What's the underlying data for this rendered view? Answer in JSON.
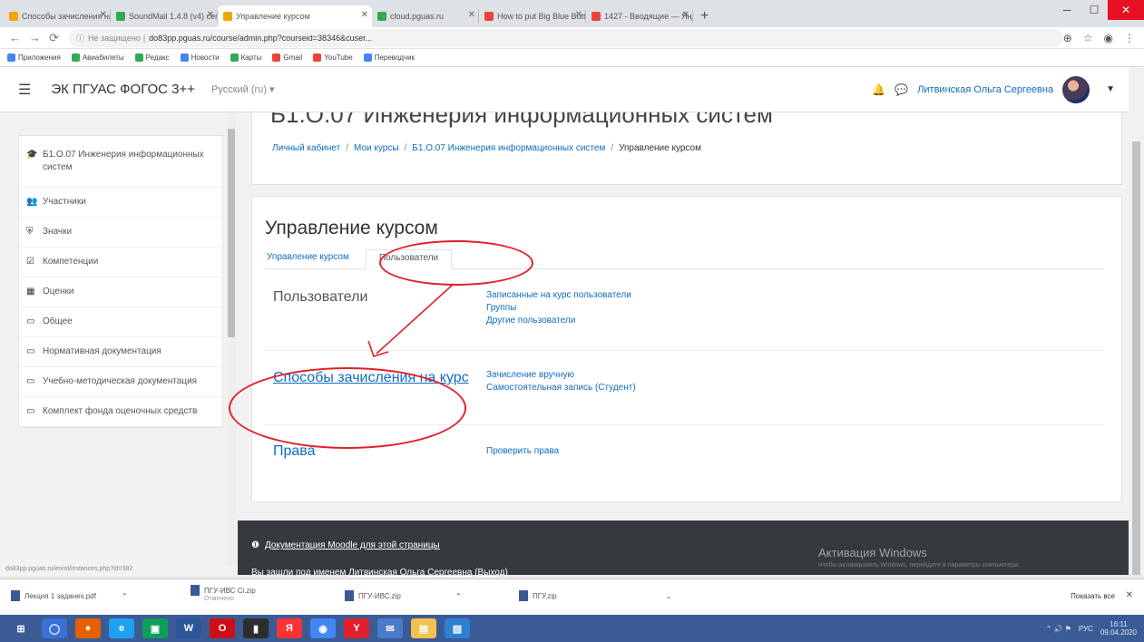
{
  "browser": {
    "tabs": [
      {
        "label": "Способы зачисления на курс",
        "color": "#f4a400"
      },
      {
        "label": "SoundMail 1.4.8 (v4) cemr...",
        "color": "#34a853"
      },
      {
        "label": "Управление курсом",
        "color": "#f4a400",
        "active": true
      },
      {
        "label": "cloud.pguas.ru",
        "color": "#34a853"
      },
      {
        "label": "How to put Big Blue Button i...",
        "color": "#ea4335"
      },
      {
        "label": "1427 - Вводящие — Яндекс...",
        "color": "#ea4335"
      }
    ],
    "url_prefix": "Не защищено",
    "url": "do83pp.pguas.ru/course/admin.php?courseid=38346&cuser...",
    "bookmarks": [
      {
        "label": "Приложения",
        "color": "#4285f4"
      },
      {
        "label": "Авиабилеты",
        "color": "#34a853"
      },
      {
        "label": "Редакс",
        "color": "#34a853"
      },
      {
        "label": "Новости",
        "color": "#4285f4"
      },
      {
        "label": "Карты",
        "color": "#34a853"
      },
      {
        "label": "Gmail",
        "color": "#ea4335"
      },
      {
        "label": "YouTube",
        "color": "#ea4335"
      },
      {
        "label": "Переводчик",
        "color": "#4285f4"
      }
    ]
  },
  "navbar": {
    "brand": "ЭК ПГУАС ФОГОС 3++",
    "lang": "Русский (ru) ▾",
    "user": "Литвинская Ольга Сергеевна"
  },
  "drawer": {
    "items": [
      {
        "icon": "graduation-cap",
        "glyph": "🎓",
        "label": "Б1.О.07 Инженерия информационных систем"
      },
      {
        "icon": "users",
        "glyph": "👥",
        "label": "Участники"
      },
      {
        "icon": "shield",
        "glyph": "⛨",
        "label": "Значки"
      },
      {
        "icon": "checkbox",
        "glyph": "☑",
        "label": "Компетенции"
      },
      {
        "icon": "table",
        "glyph": "▦",
        "label": "Оценки"
      },
      {
        "icon": "folder",
        "glyph": "▭",
        "label": "Общее"
      },
      {
        "icon": "folder",
        "glyph": "▭",
        "label": "Нормативная документация"
      },
      {
        "icon": "folder",
        "glyph": "▭",
        "label": "Учебно-методическая документация"
      },
      {
        "icon": "folder",
        "glyph": "▭",
        "label": "Комплект фонда оценочных средств"
      }
    ]
  },
  "page": {
    "ghost_heading": "Б1.О.07 Инженерия информационных систем",
    "breadcrumb": [
      "Личный кабинет",
      "Мои курсы",
      "Б1.О.07 Инженерия информационных систем",
      "Управление курсом"
    ],
    "title": "Управление курсом",
    "tabs": [
      "Управление курсом",
      "Пользователи"
    ],
    "sections": [
      {
        "heading": "Пользователи",
        "links": [
          "Записанные на курс пользователи",
          "Группы",
          "Другие пользователи"
        ]
      },
      {
        "heading": "Способы зачисления на курс",
        "links": [
          "Зачисление вручную",
          "Самостоятельная запись (Студент)"
        ]
      },
      {
        "heading": "Права",
        "links": [
          "Проверить права"
        ]
      }
    ]
  },
  "footer": {
    "doc_link": "Документация Moodle для этой страницы",
    "logged_prefix": "Вы зашли под именем",
    "logged_user": "Литвинская Ольга Сергеевна",
    "logout": "(Выход)",
    "watermark": "Активация Windows",
    "watermark_sub": "Чтобы активировать Windows, перейдите в параметры компьютера."
  },
  "status_url": "do83pp.pguas.ru/enrol/instances.php?id=382",
  "downloads": {
    "items": [
      "Лекция 1 заданеs.pdf",
      "ПГУ-ИВС Ci.zip",
      "ПГУ-ИВС.zip",
      "ПГУ.zip"
    ],
    "item2_sub": "Отменено",
    "show_all": "Показать все"
  },
  "taskbar": {
    "apps": [
      "windows",
      "chrome",
      "firefox",
      "ie",
      "edge-green",
      "word",
      "opera",
      "app",
      "yandex",
      "chrome2",
      "yandex-browser",
      "mail",
      "explorer",
      "photos"
    ],
    "time": "16:11",
    "date": "09.04.2020",
    "lang": "РУС"
  },
  "colors": {
    "link": "#0f6cbf",
    "annotation": "#e0202a",
    "footer_bg": "#373a3c",
    "taskbar": "#3a5b95"
  }
}
